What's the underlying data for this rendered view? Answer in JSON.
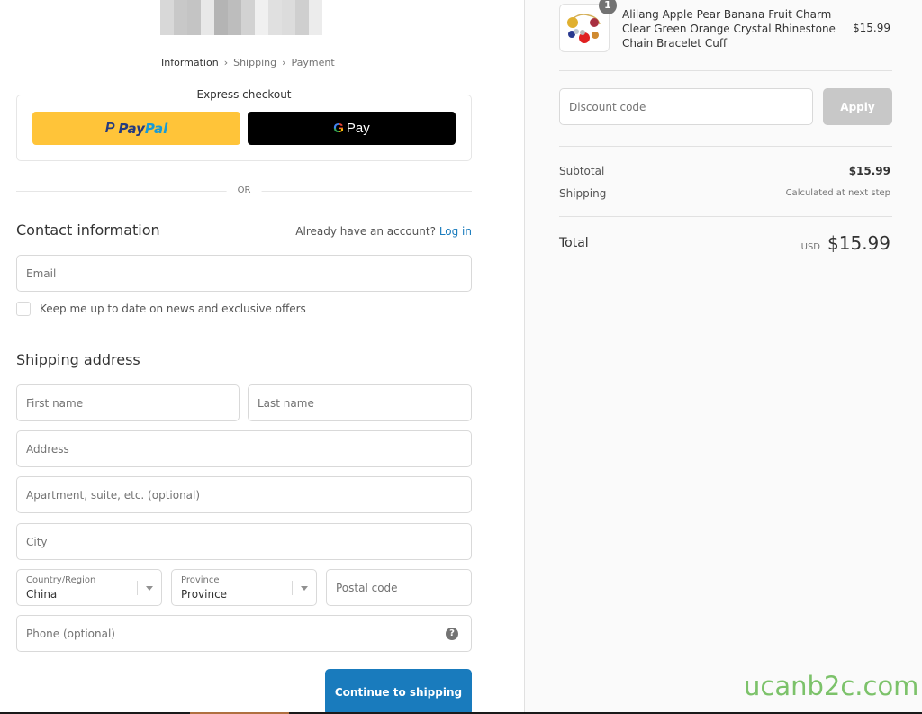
{
  "breadcrumb": {
    "items": [
      {
        "label": "Information",
        "active": true
      },
      {
        "label": "Shipping",
        "active": false
      },
      {
        "label": "Payment",
        "active": false
      }
    ],
    "separator": "›"
  },
  "express_checkout": {
    "title": "Express checkout",
    "paypal": {
      "icon": "P",
      "pay": "Pay",
      "pal": "Pal"
    },
    "gpay": {
      "icon": "G",
      "label": "Pay"
    }
  },
  "or_label": "OR",
  "contact": {
    "title": "Contact information",
    "account_prompt": "Already have an account?",
    "login_link": "Log in",
    "email_placeholder": "Email",
    "newsletter_label": "Keep me up to date on news and exclusive offers",
    "newsletter_checked": false
  },
  "shipping": {
    "title": "Shipping address",
    "first_name_placeholder": "First name",
    "last_name_placeholder": "Last name",
    "address_placeholder": "Address",
    "apartment_placeholder": "Apartment, suite, etc. (optional)",
    "city_placeholder": "City",
    "country": {
      "label": "Country/Region",
      "value": "China"
    },
    "province": {
      "label": "Province",
      "value": "Province"
    },
    "postal_placeholder": "Postal code",
    "phone_placeholder": "Phone (optional)",
    "help_icon": "?"
  },
  "continue_button": "Continue to shipping",
  "order_summary": {
    "product": {
      "name": "Alilang Apple Pear Banana Fruit Charm Clear Green Orange Crystal Rhinestone Chain Bracelet Cuff",
      "quantity": "1",
      "price": "$15.99"
    },
    "discount_placeholder": "Discount code",
    "apply_label": "Apply",
    "subtotal_label": "Subtotal",
    "subtotal_value": "$15.99",
    "shipping_label": "Shipping",
    "shipping_value": "Calculated at next step",
    "total_label": "Total",
    "total_currency": "USD",
    "total_value": "$15.99"
  },
  "watermark": "ucanb2c.com",
  "colors": {
    "accent": "#197bbd",
    "paypal_yellow": "#ffc439",
    "watermark_green": "#7cc26a"
  }
}
